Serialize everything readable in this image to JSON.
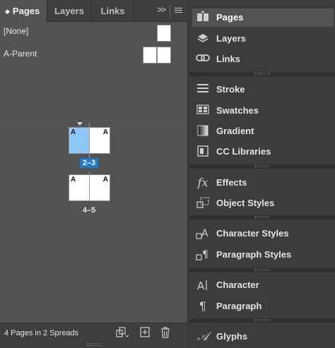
{
  "pages_panel": {
    "tabs": [
      {
        "label": "Pages",
        "active": true
      },
      {
        "label": "Layers",
        "active": false
      },
      {
        "label": "Links",
        "active": false
      }
    ],
    "collapse_glyph": ">>",
    "masters": [
      {
        "label": "[None]"
      },
      {
        "label": "A-Parent"
      }
    ],
    "spreads": [
      {
        "label": "2–3",
        "selected": true,
        "left_prefix": "A",
        "right_prefix": "A"
      },
      {
        "label": "4–5",
        "selected": false,
        "left_prefix": "A",
        "right_prefix": "A"
      }
    ],
    "status": "4 Pages in 2 Spreads",
    "footer_icons": [
      "edit-page-size-icon",
      "new-page-icon",
      "delete-page-icon"
    ],
    "colors": {
      "selection_page": "#8ec6f7",
      "selection_label": "#1f7ac9"
    }
  },
  "dock": {
    "groups": [
      {
        "items": [
          {
            "label": "Pages",
            "icon": "pages-icon",
            "active": true
          },
          {
            "label": "Layers",
            "icon": "layers-icon"
          },
          {
            "label": "Links",
            "icon": "links-icon"
          }
        ]
      },
      {
        "items": [
          {
            "label": "Stroke",
            "icon": "stroke-icon"
          },
          {
            "label": "Swatches",
            "icon": "swatches-icon"
          },
          {
            "label": "Gradient",
            "icon": "gradient-icon"
          },
          {
            "label": "CC Libraries",
            "icon": "cc-libraries-icon"
          }
        ]
      },
      {
        "items": [
          {
            "label": "Effects",
            "icon": "effects-icon"
          },
          {
            "label": "Object Styles",
            "icon": "object-styles-icon"
          }
        ]
      },
      {
        "items": [
          {
            "label": "Character Styles",
            "icon": "character-styles-icon"
          },
          {
            "label": "Paragraph Styles",
            "icon": "paragraph-styles-icon"
          }
        ]
      },
      {
        "items": [
          {
            "label": "Character",
            "icon": "character-icon"
          },
          {
            "label": "Paragraph",
            "icon": "paragraph-icon"
          }
        ]
      },
      {
        "items": [
          {
            "label": "Glyphs",
            "icon": "glyphs-icon"
          }
        ]
      }
    ]
  }
}
